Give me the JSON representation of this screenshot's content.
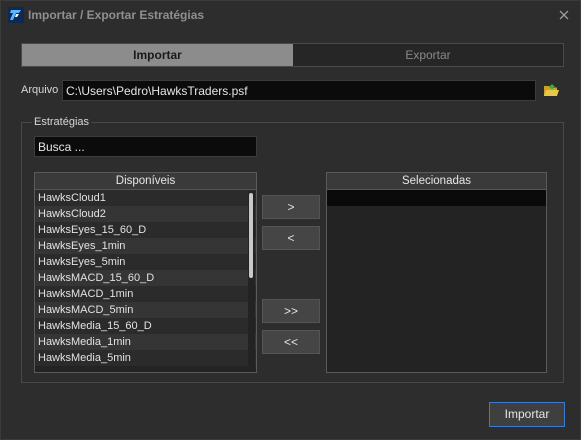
{
  "window": {
    "title": "Importar / Exportar Estratégias",
    "app_icon": "app-logo-icon",
    "close_icon": "close-icon"
  },
  "tabs": [
    {
      "label": "Importar",
      "active": true
    },
    {
      "label": "Exportar",
      "active": false
    }
  ],
  "file": {
    "label": "Arquivo",
    "value": "C:\\Users\\Pedro\\HawksTraders.psf",
    "browse_icon": "folder-open-icon"
  },
  "strategies": {
    "group_title": "Estratégias",
    "search_value": "Busca ...",
    "available": {
      "header": "Disponíveis",
      "items": [
        "HawksCloud1",
        "HawksCloud2",
        "HawksEyes_15_60_D",
        "HawksEyes_1min",
        "HawksEyes_5min",
        "HawksMACD_15_60_D",
        "HawksMACD_1min",
        "HawksMACD_5min",
        "HawksMedia_15_60_D",
        "HawksMedia_1min",
        "HawksMedia_5min"
      ]
    },
    "selected": {
      "header": "Selecionadas",
      "items": []
    },
    "buttons": {
      "add": ">",
      "remove": "<",
      "add_all": ">>",
      "remove_all": "<<"
    }
  },
  "footer": {
    "import_label": "Importar"
  },
  "colors": {
    "background": "#2d2d2d",
    "input_bg": "#0b0b0b",
    "active_tab": "#8c8c8c",
    "accent_border": "#3a7bd0",
    "scroll_thumb": "#c9c9c9"
  }
}
